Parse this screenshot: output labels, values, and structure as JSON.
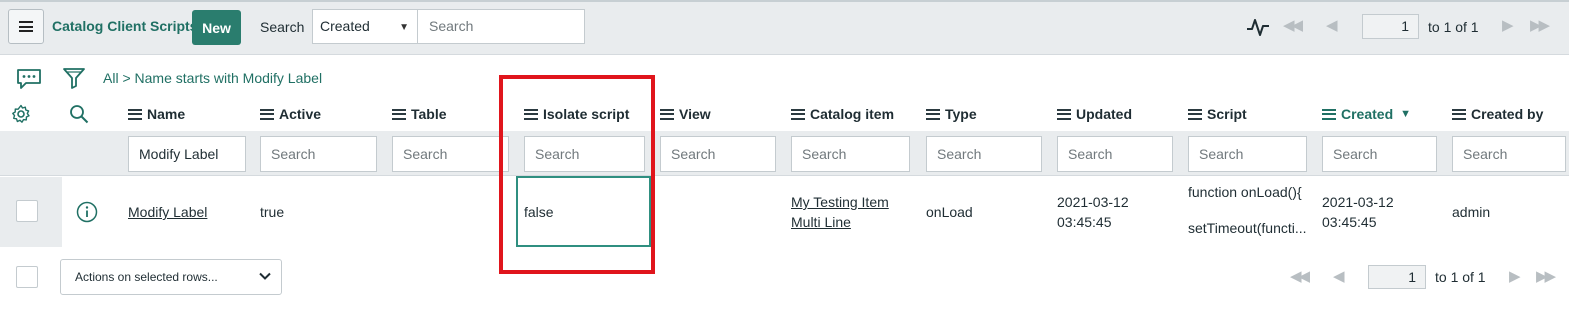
{
  "header": {
    "list_title": "Catalog Client Scripts",
    "new_label": "New",
    "search_label": "Search",
    "search_field": "Created",
    "search_placeholder": "Search",
    "pagination": {
      "current": "1",
      "range": "to 1 of 1"
    }
  },
  "breadcrumb": {
    "all": "All",
    "separator": ">",
    "condition": "Name starts with Modify Label"
  },
  "columns": [
    {
      "label": "Name"
    },
    {
      "label": "Active"
    },
    {
      "label": "Table"
    },
    {
      "label": "Isolate script"
    },
    {
      "label": "View"
    },
    {
      "label": "Catalog item"
    },
    {
      "label": "Type"
    },
    {
      "label": "Updated"
    },
    {
      "label": "Script"
    },
    {
      "label": "Created",
      "sorted": "descending"
    },
    {
      "label": "Created by"
    }
  ],
  "filters": {
    "name": "Modify Label",
    "placeholder": "Search"
  },
  "row": {
    "name": "Modify Label",
    "active": "true",
    "table": "",
    "isolate_script": "false",
    "view": "",
    "catalog_item_line1": "My Testing Item",
    "catalog_item_line2": "Multi Line",
    "type": "onLoad",
    "updated_date": "2021-03-12",
    "updated_time": "03:45:45",
    "script_line1": "function onLoad(){",
    "script_line2": "setTimeout(functi...",
    "created_date": "2021-03-12",
    "created_time": "03:45:45",
    "created_by": "admin"
  },
  "footer": {
    "actions_label": "Actions on selected rows...",
    "pagination": {
      "current": "1",
      "range": "to 1 of 1"
    }
  },
  "colors": {
    "accent": "#2a7d6e",
    "link": "#207064",
    "highlight": "#e0151c",
    "band": "#e9ecee"
  },
  "icons": [
    "menu-icon",
    "activity-stream-icon",
    "first-page-icon",
    "previous-page-icon",
    "next-page-icon",
    "last-page-icon",
    "comment-icon",
    "filter-icon",
    "gear-icon",
    "search-icon",
    "info-icon",
    "chevron-down-icon",
    "sort-descending-icon"
  ]
}
